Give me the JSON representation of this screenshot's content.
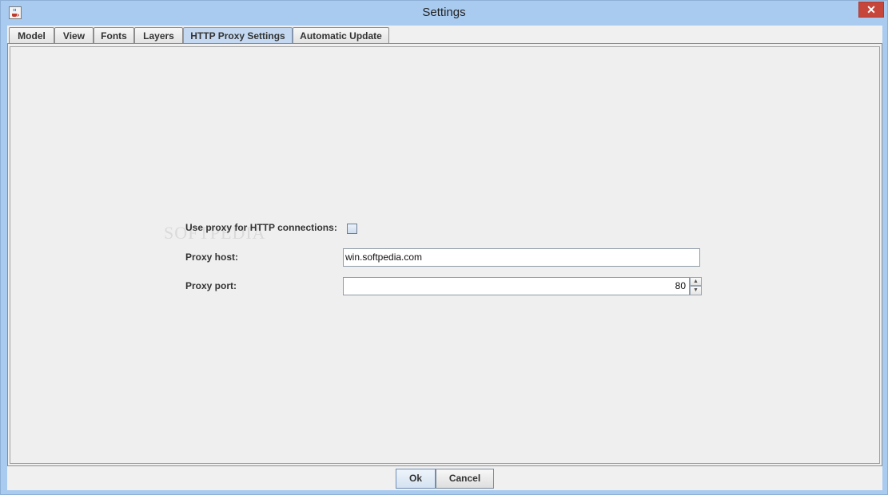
{
  "window": {
    "title": "Settings",
    "close_glyph": "✕",
    "icon": "java-cup-icon"
  },
  "tabs": [
    {
      "label": "Model"
    },
    {
      "label": "View"
    },
    {
      "label": "Fonts"
    },
    {
      "label": "Layers"
    },
    {
      "label": "HTTP Proxy Settings",
      "active": true
    },
    {
      "label": "Automatic Update"
    }
  ],
  "proxy": {
    "use_proxy_label": "Use proxy for HTTP connections:",
    "use_proxy_checked": false,
    "host_label": "Proxy host:",
    "host_value": "win.softpedia.com",
    "port_label": "Proxy port:",
    "port_value": "80",
    "spin_up": "▲",
    "spin_down": "▼"
  },
  "buttons": {
    "ok": "Ok",
    "cancel": "Cancel"
  },
  "watermark": "SOFTPEDIA",
  "colors": {
    "active_tab": "#c4d9f1",
    "close_button": "#c7463c",
    "titlebar": "#a9cbf0"
  }
}
